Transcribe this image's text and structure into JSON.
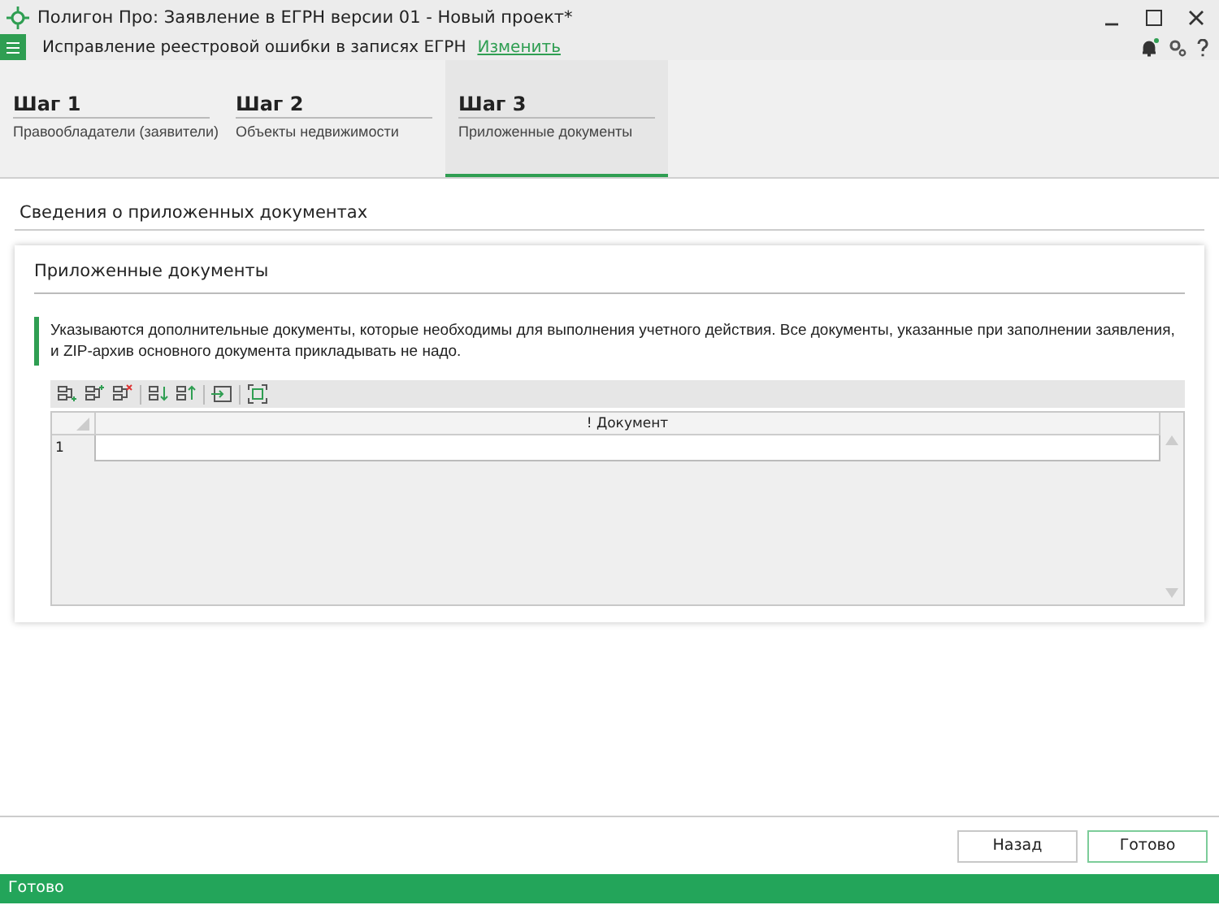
{
  "window": {
    "title": "Полигон Про: Заявление в ЕГРН версии 01 - Новый проект*"
  },
  "toolbar": {
    "caption": "Исправление реестровой ошибки в записях ЕГРН",
    "link": "Изменить",
    "notification": true
  },
  "steps": [
    {
      "title": "Шаг 1",
      "subtitle": "Правообладатели (заявители)",
      "selected": false
    },
    {
      "title": "Шаг 2",
      "subtitle": "Объекты недвижимости",
      "selected": false
    },
    {
      "title": "Шаг 3",
      "subtitle": "Приложенные документы",
      "selected": true
    }
  ],
  "section": {
    "title": "Сведения о приложенных документах"
  },
  "card": {
    "title": "Приложенные документы",
    "hint": "Указываются дополнительные документы, которые необходимы для выполнения учетного действия. Все документы, указанные при заполнении заявления, и ZIP-архив основного документа прикладывать не надо."
  },
  "table": {
    "columns": [
      "! Документ"
    ],
    "rows": [
      {
        "number": "1"
      }
    ]
  },
  "buttons": [
    {
      "label": "Назад",
      "kind": "plain"
    },
    {
      "label": "Готово",
      "kind": "primary"
    }
  ],
  "status_bar": {
    "text": "Готово"
  }
}
